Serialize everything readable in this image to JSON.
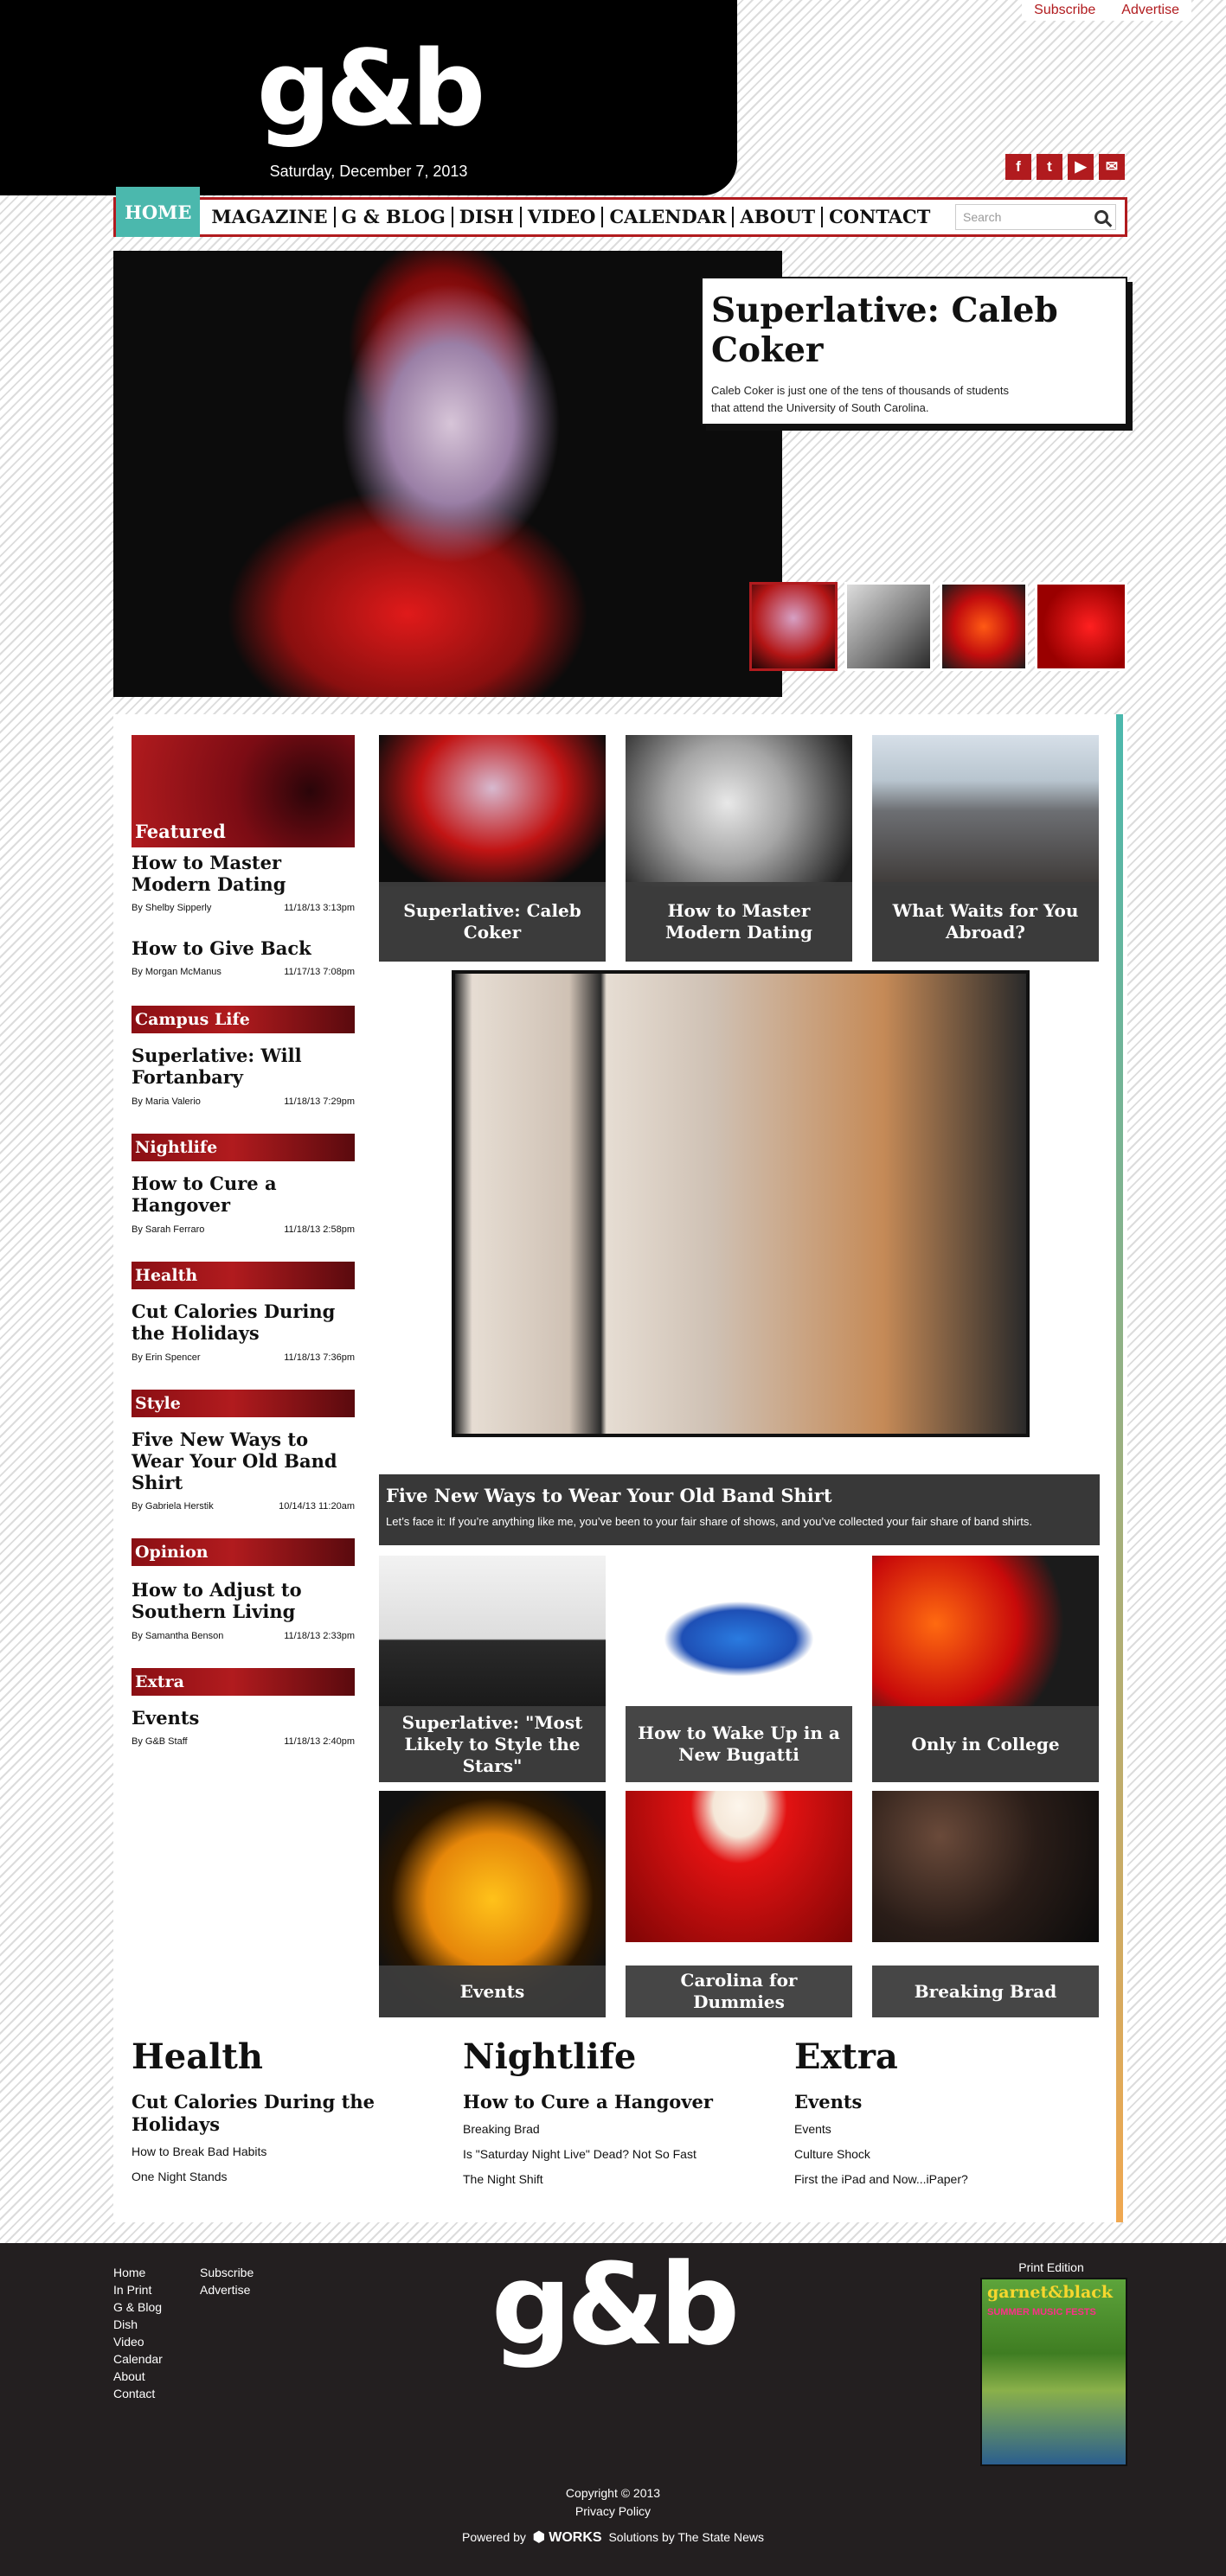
{
  "top_links": [
    "Subscribe",
    "Advertise"
  ],
  "brand": {
    "logo": "g&b",
    "date": "Saturday, December 7, 2013"
  },
  "social": [
    {
      "icon": "facebook-icon",
      "glyph": "f"
    },
    {
      "icon": "twitter-icon",
      "glyph": "t"
    },
    {
      "icon": "youtube-icon",
      "glyph": "▶"
    },
    {
      "icon": "email-icon",
      "glyph": "✉"
    }
  ],
  "nav": {
    "items": [
      "HOME",
      "MAGAZINE",
      "G & BLOG",
      "DISH",
      "VIDEO",
      "CALENDAR",
      "ABOUT",
      "CONTACT"
    ],
    "search_placeholder": "Search"
  },
  "hero": {
    "title": "Superlative: Caleb Coker",
    "desc": "Caleb Coker is just one of the tens of thousands of students that attend the University of South Carolina."
  },
  "sidebar": {
    "featured_label": "Featured",
    "featured": [
      {
        "title": "How to Master Modern Dating",
        "author": "By Shelby Sipperly",
        "date": "11/18/13 3:13pm"
      },
      {
        "title": "How to Give Back",
        "author": "By Morgan McManus",
        "date": "11/17/13 7:08pm"
      }
    ],
    "sections": [
      {
        "cat": "Campus Life",
        "title": "Superlative: Will Fortanbary",
        "author": "By Maria Valerio",
        "date": "11/18/13 7:29pm"
      },
      {
        "cat": "Nightlife",
        "title": "How to Cure a Hangover",
        "author": "By Sarah Ferraro",
        "date": "11/18/13 2:58pm"
      },
      {
        "cat": "Health",
        "title": "Cut Calories During the Holidays",
        "author": "By Erin Spencer",
        "date": "11/18/13 7:36pm"
      },
      {
        "cat": "Style",
        "title": "Five New Ways to Wear Your Old Band Shirt",
        "author": "By Gabriela Herstik",
        "date": "10/14/13 11:20am"
      },
      {
        "cat": "Opinion",
        "title": "How to Adjust to Southern Living",
        "author": "By Samantha Benson",
        "date": "11/18/13 2:33pm"
      },
      {
        "cat": "Extra",
        "title": "Events",
        "author": "By G&B Staff",
        "date": "11/18/13 2:40pm"
      }
    ]
  },
  "grid": {
    "row1": [
      "Superlative: Caleb Coker",
      "How to Master Modern Dating",
      "What Waits for You Abroad?"
    ],
    "feature": {
      "title": "Five New Ways to Wear Your Old Band Shirt",
      "desc": "Let’s face it: If you’re anything like me, you’ve been to your fair share of shows, and you’ve collected your fair share of band shirts."
    },
    "row2": [
      "Superlative: \"Most Likely to Style the Stars\"",
      "How to Wake Up in a New Bugatti",
      "Only in College"
    ],
    "row3": [
      "Events",
      "Carolina for Dummies",
      "Breaking Brad"
    ]
  },
  "bottom_sections": [
    {
      "heading": "Health",
      "lead": "Cut Calories During the Holidays",
      "links": [
        "How to Break Bad Habits",
        "One Night Stands"
      ]
    },
    {
      "heading": "Nightlife",
      "lead": "How to Cure a Hangover",
      "links": [
        "Breaking Brad",
        "Is \"Saturday Night Live\" Dead? Not So Fast",
        "The Night Shift"
      ]
    },
    {
      "heading": "Extra",
      "lead": "Events",
      "links": [
        "Events",
        "Culture Shock",
        "First the iPad and Now...iPaper?"
      ]
    }
  ],
  "footer": {
    "col1": [
      "Home",
      "In Print",
      "G & Blog",
      "Dish",
      "Video",
      "Calendar",
      "About",
      "Contact"
    ],
    "col2": [
      "Subscribe",
      "Advertise"
    ],
    "logo": "g&b",
    "print_label": "Print Edition",
    "print_masthead": "garnet&black",
    "print_cover_text": "SUMMER MUSIC FESTS",
    "copyright": "Copyright © 2013",
    "privacy": "Privacy Policy",
    "powered_prefix": "Powered by",
    "powered_brand": "WORKS",
    "powered_suffix": "Solutions by The State News"
  },
  "colors": {
    "brand_red": "#b11b1e",
    "teal": "#4bb8ad",
    "footer_bg": "#231f20"
  }
}
